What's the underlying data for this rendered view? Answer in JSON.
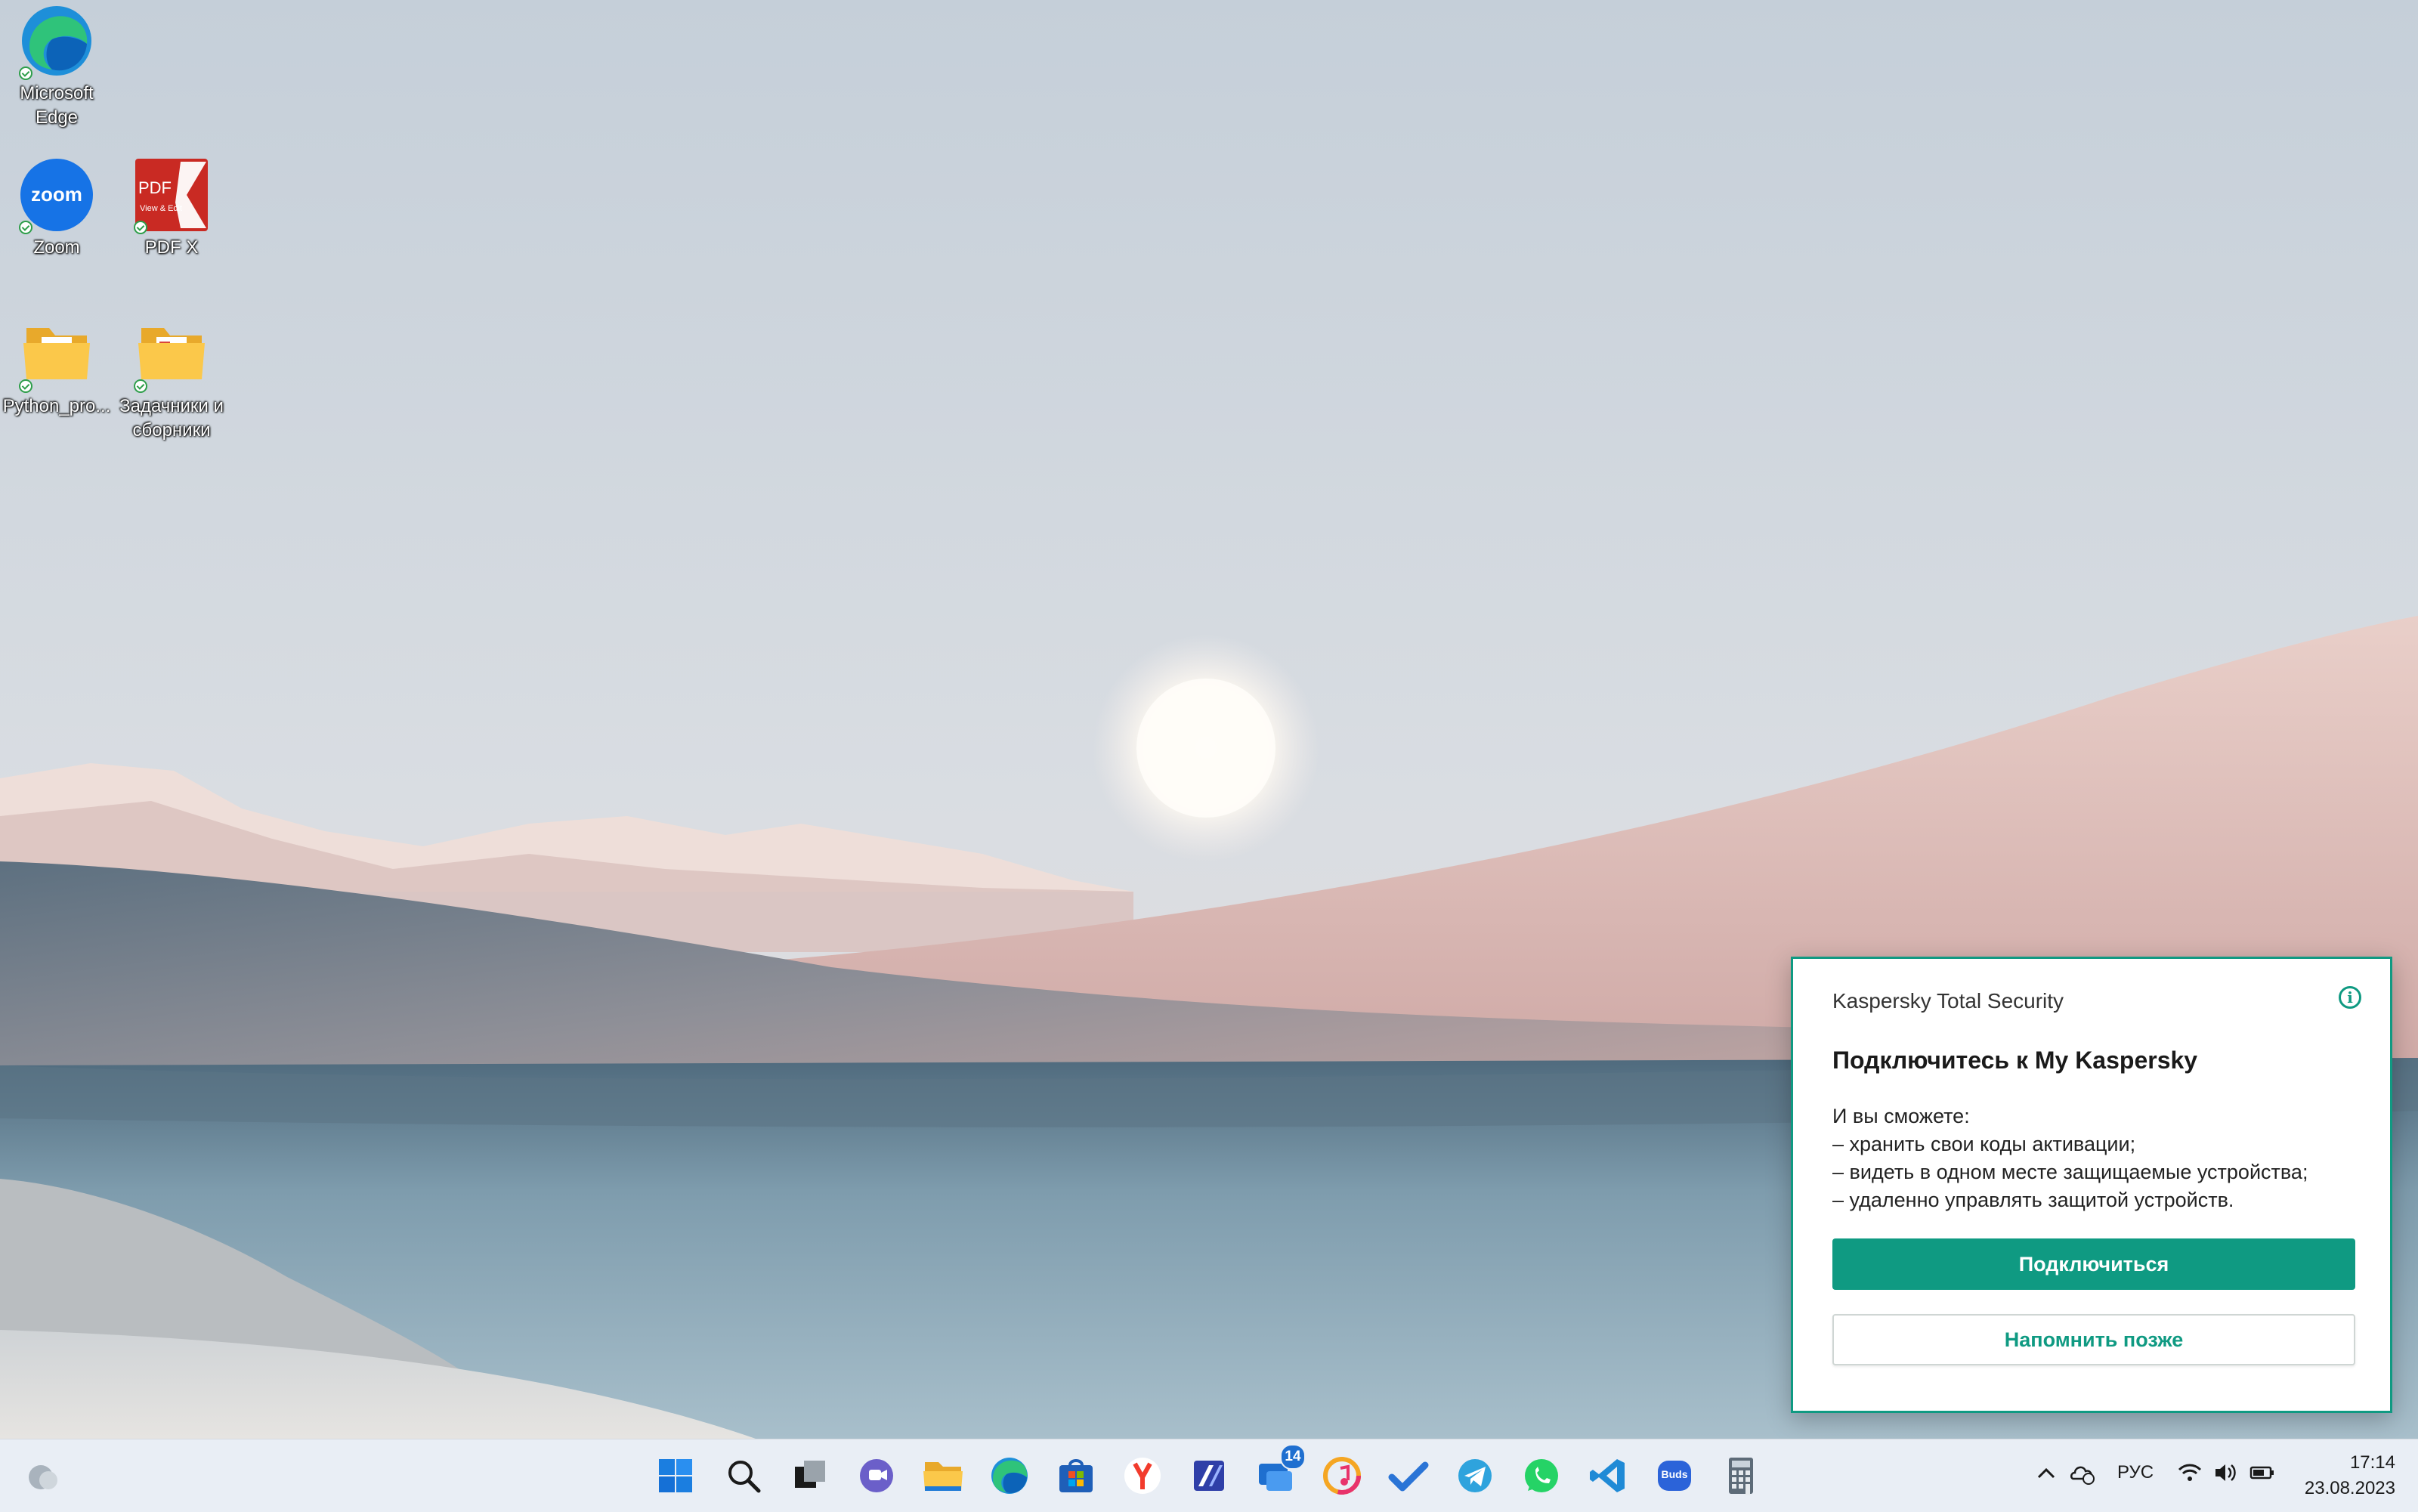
{
  "desktop": {
    "icons": [
      {
        "label_line1": "Microsoft",
        "label_line2": "Edge",
        "icon": "edge-icon"
      },
      {
        "label_line1": "Zoom",
        "label_line2": "",
        "icon": "zoom-icon",
        "glyph_text": "zoom"
      },
      {
        "label_line1": "PDF X",
        "label_line2": "",
        "icon": "pdf-x-icon",
        "glyph_text": "PDF",
        "glyph_sub": "View & Edit"
      },
      {
        "label_line1": "Python_pro...",
        "label_line2": "",
        "icon": "folder-icon"
      },
      {
        "label_line1": "Задачники и",
        "label_line2": "сборники",
        "icon": "folder-icon"
      }
    ]
  },
  "notification": {
    "app_name": "Kaspersky Total Security",
    "title": "Подключитесь к My Kaspersky",
    "body": [
      "И вы сможете:",
      "– хранить свои коды активации;",
      "– видеть в одном месте защищаемые устройства;",
      "– удаленно управлять защитой устройств."
    ],
    "primary_button": "Подключиться",
    "secondary_button": "Напомнить позже",
    "accent_color": "#0f9a82"
  },
  "taskbar": {
    "apps": [
      {
        "name": "start-button",
        "icon": "windows-logo-icon"
      },
      {
        "name": "search-button",
        "icon": "search-icon"
      },
      {
        "name": "task-view-button",
        "icon": "task-view-icon"
      },
      {
        "name": "teams-chat-button",
        "icon": "teams-chat-icon"
      },
      {
        "name": "file-explorer-button",
        "icon": "folder-icon"
      },
      {
        "name": "edge-button",
        "icon": "edge-icon"
      },
      {
        "name": "store-button",
        "icon": "store-icon"
      },
      {
        "name": "yandex-browser-button",
        "icon": "yandex-icon"
      },
      {
        "name": "typora-button",
        "icon": "edit-app-icon"
      },
      {
        "name": "messenger-button",
        "icon": "chat-icon",
        "badge": "14"
      },
      {
        "name": "music-button",
        "icon": "music-icon"
      },
      {
        "name": "todo-button",
        "icon": "checkmark-icon"
      },
      {
        "name": "telegram-button",
        "icon": "telegram-icon"
      },
      {
        "name": "whatsapp-button",
        "icon": "whatsapp-icon"
      },
      {
        "name": "vscode-button",
        "icon": "vscode-icon"
      },
      {
        "name": "galaxy-buds-button",
        "icon": "buds-icon",
        "glyph_text": "Buds"
      },
      {
        "name": "calculator-button",
        "icon": "calculator-icon"
      }
    ],
    "tray": {
      "language": "РУС",
      "time": "17:14",
      "date": "23.08.2023"
    }
  }
}
